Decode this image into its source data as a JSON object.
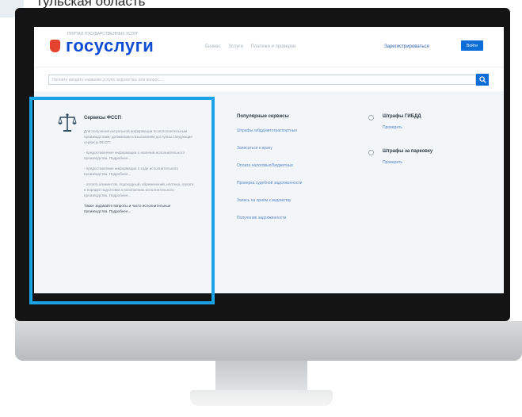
{
  "caption": "тульская область",
  "site": {
    "logo_sub": "ПОРТАЛ ГОСУДАРСТВЕННЫХ УСЛУГ",
    "logo_text": "госуслуги",
    "nav": [
      "Бизнес",
      "Услуги",
      "Платежи и проверки"
    ],
    "register": "Зарегистрироваться",
    "login": "Войти",
    "search_placeholder": "Начните вводить название услуги, ведомства, или вопрос..."
  },
  "card": {
    "icon": "scales-icon",
    "title": "Сервисы ФССП",
    "intro": "Для получения актуальной информации по исполнительным производствам, должникам и взысканиям доступны следующие сервисы ФССП:",
    "items": [
      "- предоставление информации о наличии исполнительного производства. Подробнее...",
      "- предоставление информации о ходе исполнительного производства. Подробнее...",
      "- оплата алиментов, подоходный, обременений, ипотека, оплата в порядке подготовки к исполнению исполнительного производства. Подробнее..."
    ],
    "footer": "Также задавайте вопросы и часто исполнительные производства. Подробнее..."
  },
  "popular": {
    "title": "Популярные сервисы",
    "items": [
      "Штрафы гибдд/автотраспортные",
      "Записаться к врачу",
      "Оплата налоговых/бюджетных",
      "Проверка судебной задолженности",
      "Запись на приём к ведомству",
      "Получение задолженности"
    ]
  },
  "fines": [
    {
      "title": "Штрафы ГИБДД",
      "link": "Проверить"
    },
    {
      "title": "Штрафы за парковку",
      "link": "Проверить"
    }
  ],
  "colors": {
    "brand_blue": "#0d4cd3",
    "accent_red": "#e4442f",
    "highlight": "#1aa3e6",
    "button": "#0d6ed8"
  }
}
